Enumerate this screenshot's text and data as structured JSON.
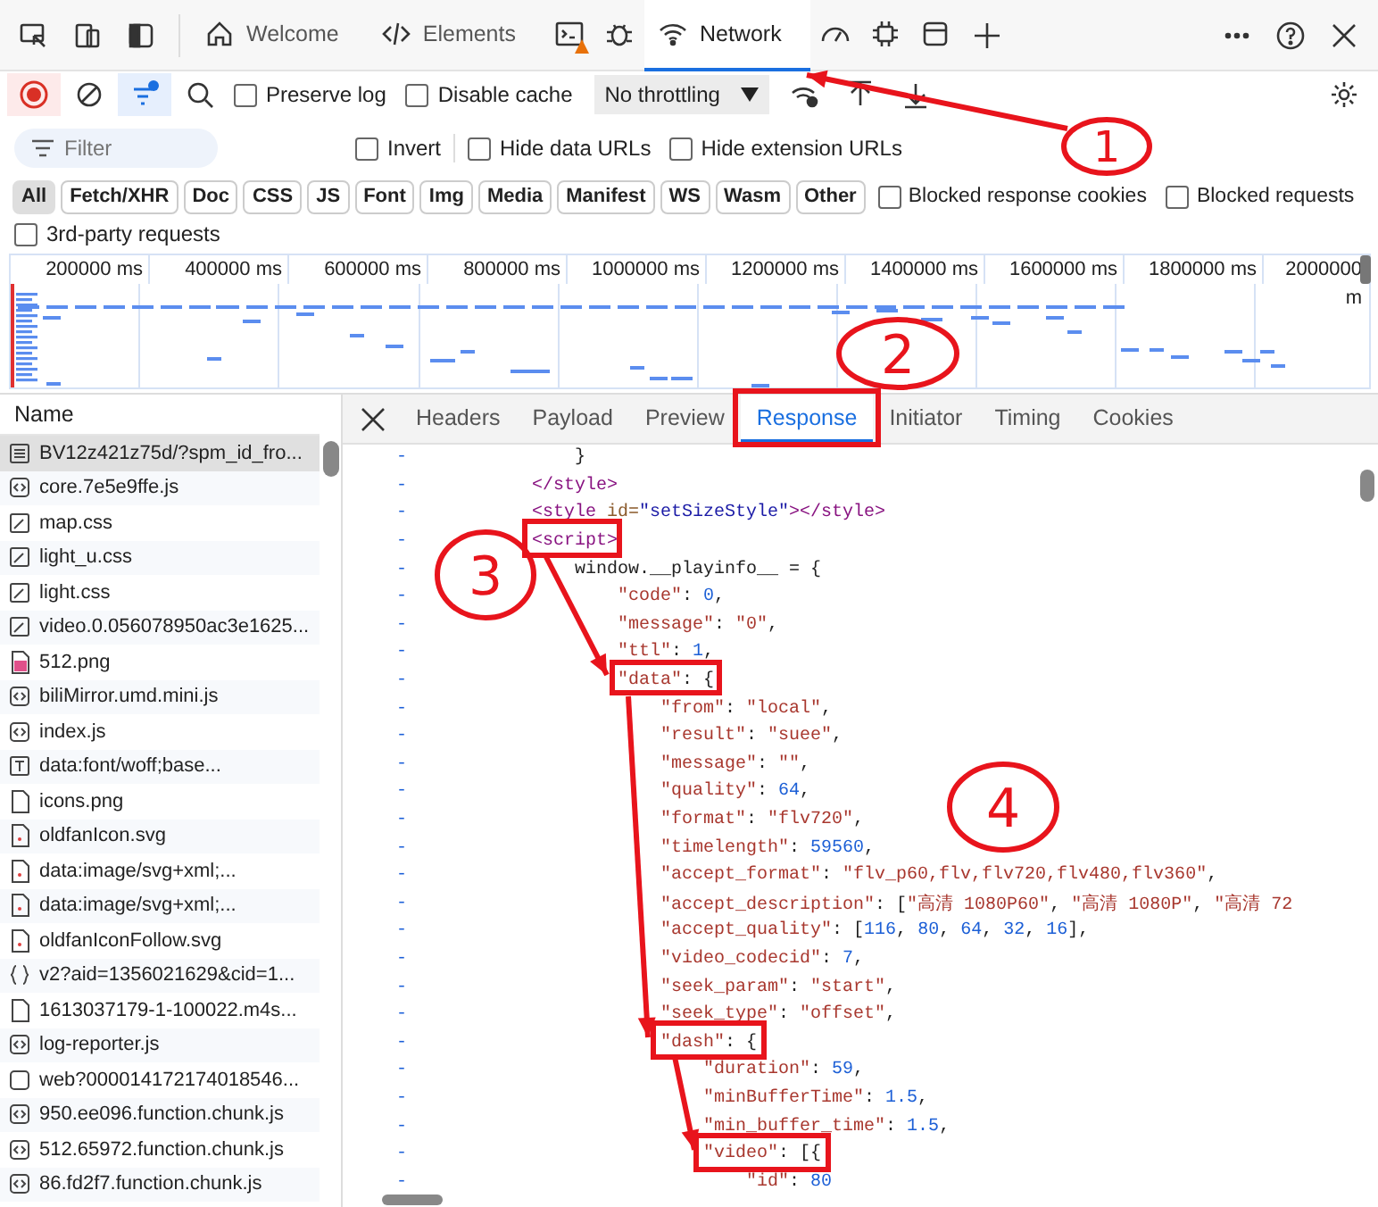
{
  "main_tabs": [
    {
      "kind": "home",
      "label": "Welcome",
      "selected": false,
      "warning": false
    },
    {
      "kind": "code",
      "label": "Elements",
      "selected": false,
      "warning": false
    },
    {
      "kind": "console",
      "selected": false,
      "warning": true
    },
    {
      "kind": "bug",
      "selected": false,
      "warning": false
    },
    {
      "kind": "wifi",
      "label": "Network",
      "selected": true,
      "warning": false
    },
    {
      "kind": "gauge",
      "selected": false,
      "warning": false
    },
    {
      "kind": "chip",
      "selected": false,
      "warning": false
    },
    {
      "kind": "window",
      "selected": false,
      "warning": false
    }
  ],
  "toolbar": {
    "recording": true,
    "filter_active": true,
    "preserve_log": {
      "label": "Preserve log",
      "checked": false
    },
    "disable_cache": {
      "label": "Disable cache",
      "checked": false
    },
    "throttling": "No throttling"
  },
  "filter": {
    "placeholder": "Filter",
    "options": [
      {
        "label": "Invert",
        "checked": false
      },
      {
        "label": "Hide data URLs",
        "checked": false
      },
      {
        "label": "Hide extension URLs",
        "checked": false
      }
    ]
  },
  "type_filters": [
    {
      "label": "All",
      "selected": true
    },
    {
      "label": "Fetch/XHR",
      "selected": false
    },
    {
      "label": "Doc",
      "selected": false
    },
    {
      "label": "CSS",
      "selected": false
    },
    {
      "label": "JS",
      "selected": false
    },
    {
      "label": "Font",
      "selected": false
    },
    {
      "label": "Img",
      "selected": false
    },
    {
      "label": "Media",
      "selected": false
    },
    {
      "label": "Manifest",
      "selected": false
    },
    {
      "label": "WS",
      "selected": false
    },
    {
      "label": "Wasm",
      "selected": false
    },
    {
      "label": "Other",
      "selected": false
    }
  ],
  "blocked_options": [
    {
      "label": "Blocked response cookies",
      "checked": false
    },
    {
      "label": "Blocked requests",
      "checked": false
    }
  ],
  "third_party": {
    "label": "3rd-party requests",
    "checked": false
  },
  "timeline_ticks": [
    "200000 ms",
    "400000 ms",
    "600000 ms",
    "800000 ms",
    "1000000 ms",
    "1200000 ms",
    "1400000 ms",
    "1600000 ms",
    "1800000 ms",
    "2000000 m"
  ],
  "requests": {
    "header": "Name",
    "rows": [
      {
        "name": "BV12z421z75d/?spm_id_fro...",
        "kind": "document",
        "selected": true
      },
      {
        "name": "core.7e5e9ffe.js",
        "kind": "script",
        "selected": false
      },
      {
        "name": "map.css",
        "kind": "stylesheet",
        "selected": false
      },
      {
        "name": "light_u.css",
        "kind": "stylesheet",
        "selected": false
      },
      {
        "name": "light.css",
        "kind": "stylesheet",
        "selected": false
      },
      {
        "name": "video.0.056078950ac3e1625...",
        "kind": "stylesheet",
        "selected": false
      },
      {
        "name": "512.png",
        "kind": "image",
        "selected": false
      },
      {
        "name": "biliMirror.umd.mini.js",
        "kind": "script",
        "selected": false
      },
      {
        "name": "index.js",
        "kind": "script",
        "selected": false
      },
      {
        "name": "data:font/woff;base...",
        "kind": "font",
        "selected": false
      },
      {
        "name": "icons.png",
        "kind": "file",
        "selected": false
      },
      {
        "name": "oldfanIcon.svg",
        "kind": "svg",
        "selected": false
      },
      {
        "name": "data:image/svg+xml;...",
        "kind": "svg",
        "selected": false
      },
      {
        "name": "data:image/svg+xml;...",
        "kind": "svg",
        "selected": false
      },
      {
        "name": "oldfanIconFollow.svg",
        "kind": "svg",
        "selected": false
      },
      {
        "name": "v2?aid=1356021629&cid=1...",
        "kind": "fetch",
        "selected": false
      },
      {
        "name": "1613037179-1-100022.m4s...",
        "kind": "file",
        "selected": false
      },
      {
        "name": "log-reporter.js",
        "kind": "script",
        "selected": false
      },
      {
        "name": "web?000014172174018546...",
        "kind": "other",
        "selected": false
      },
      {
        "name": "950.ee096.function.chunk.js",
        "kind": "script",
        "selected": false
      },
      {
        "name": "512.65972.function.chunk.js",
        "kind": "script",
        "selected": false
      },
      {
        "name": "86.fd2f7.function.chunk.js",
        "kind": "script",
        "selected": false
      }
    ]
  },
  "detail_tabs": [
    {
      "label": "Headers",
      "selected": false
    },
    {
      "label": "Payload",
      "selected": false
    },
    {
      "label": "Preview",
      "selected": false
    },
    {
      "label": "Response",
      "selected": true
    },
    {
      "label": "Initiator",
      "selected": false
    },
    {
      "label": "Timing",
      "selected": false
    },
    {
      "label": "Cookies",
      "selected": false
    }
  ],
  "response_lines": [
    {
      "children": [
        {
          "marker": "-",
          "tokens": [
            {
              "kind": "punct",
              "text": "}"
            }
          ]
        }
      ]
    },
    {
      "marker": "-",
      "tokens": [
        {
          "kind": "tag",
          "text": "</style>"
        }
      ]
    },
    {
      "marker": "-",
      "tokens": [
        {
          "kind": "tag",
          "text": "<style"
        },
        {
          "kind": "attr",
          "text": " id="
        },
        {
          "kind": "value",
          "text": "\"setSizeStyle\""
        },
        {
          "kind": "tag",
          "text": "></style>"
        }
      ]
    },
    {
      "marker": "-",
      "tokens": [
        {
          "kind": "tag",
          "text": "<script>"
        }
      ],
      "children": [
        {
          "marker": "-",
          "tokens": [
            {
              "kind": "punct",
              "text": "window.__playinfo__ = {"
            }
          ],
          "children": [
            {
              "marker": "-",
              "tokens": [
                {
                  "kind": "key",
                  "text": "\"code\""
                },
                {
                  "kind": "punct",
                  "text": ": "
                },
                {
                  "kind": "num",
                  "text": "0"
                },
                {
                  "kind": "punct",
                  "text": ","
                }
              ]
            },
            {
              "marker": "-",
              "tokens": [
                {
                  "kind": "key",
                  "text": "\"message\""
                },
                {
                  "kind": "punct",
                  "text": ": "
                },
                {
                  "kind": "str",
                  "text": "\"0\""
                },
                {
                  "kind": "punct",
                  "text": ","
                }
              ]
            },
            {
              "marker": "-",
              "tokens": [
                {
                  "kind": "key",
                  "text": "\"ttl\""
                },
                {
                  "kind": "punct",
                  "text": ": "
                },
                {
                  "kind": "num",
                  "text": "1"
                },
                {
                  "kind": "punct",
                  "text": ","
                }
              ]
            },
            {
              "marker": "-",
              "tokens": [
                {
                  "kind": "key",
                  "text": "\"data\""
                },
                {
                  "kind": "punct",
                  "text": ": {"
                }
              ],
              "children": [
                {
                  "marker": "-",
                  "tokens": [
                    {
                      "kind": "key",
                      "text": "\"from\""
                    },
                    {
                      "kind": "punct",
                      "text": ": "
                    },
                    {
                      "kind": "str",
                      "text": "\"local\""
                    },
                    {
                      "kind": "punct",
                      "text": ","
                    }
                  ]
                },
                {
                  "marker": "-",
                  "tokens": [
                    {
                      "kind": "key",
                      "text": "\"result\""
                    },
                    {
                      "kind": "punct",
                      "text": ": "
                    },
                    {
                      "kind": "str",
                      "text": "\"suee\""
                    },
                    {
                      "kind": "punct",
                      "text": ","
                    }
                  ]
                },
                {
                  "marker": "-",
                  "tokens": [
                    {
                      "kind": "key",
                      "text": "\"message\""
                    },
                    {
                      "kind": "punct",
                      "text": ": "
                    },
                    {
                      "kind": "str",
                      "text": "\"\""
                    },
                    {
                      "kind": "punct",
                      "text": ","
                    }
                  ]
                },
                {
                  "marker": "-",
                  "tokens": [
                    {
                      "kind": "key",
                      "text": "\"quality\""
                    },
                    {
                      "kind": "punct",
                      "text": ": "
                    },
                    {
                      "kind": "num",
                      "text": "64"
                    },
                    {
                      "kind": "punct",
                      "text": ","
                    }
                  ]
                },
                {
                  "marker": "-",
                  "tokens": [
                    {
                      "kind": "key",
                      "text": "\"format\""
                    },
                    {
                      "kind": "punct",
                      "text": ": "
                    },
                    {
                      "kind": "str",
                      "text": "\"flv720\""
                    },
                    {
                      "kind": "punct",
                      "text": ","
                    }
                  ]
                },
                {
                  "marker": "-",
                  "tokens": [
                    {
                      "kind": "key",
                      "text": "\"timelength\""
                    },
                    {
                      "kind": "punct",
                      "text": ": "
                    },
                    {
                      "kind": "num",
                      "text": "59560"
                    },
                    {
                      "kind": "punct",
                      "text": ","
                    }
                  ]
                },
                {
                  "marker": "-",
                  "tokens": [
                    {
                      "kind": "key",
                      "text": "\"accept_format\""
                    },
                    {
                      "kind": "punct",
                      "text": ": "
                    },
                    {
                      "kind": "str",
                      "text": "\"flv_p60,flv,flv720,flv480,flv360\""
                    },
                    {
                      "kind": "punct",
                      "text": ","
                    }
                  ]
                },
                {
                  "marker": "-",
                  "tokens": [
                    {
                      "kind": "key",
                      "text": "\"accept_description\""
                    },
                    {
                      "kind": "punct",
                      "text": ": ["
                    },
                    {
                      "kind": "str",
                      "text": "\"高清 1080P60\""
                    },
                    {
                      "kind": "punct",
                      "text": ", "
                    },
                    {
                      "kind": "str",
                      "text": "\"高清 1080P\""
                    },
                    {
                      "kind": "punct",
                      "text": ", "
                    },
                    {
                      "kind": "str",
                      "text": "\"高清 72"
                    }
                  ]
                },
                {
                  "marker": "-",
                  "tokens": [
                    {
                      "kind": "key",
                      "text": "\"accept_quality\""
                    },
                    {
                      "kind": "punct",
                      "text": ": ["
                    },
                    {
                      "kind": "num",
                      "text": "116"
                    },
                    {
                      "kind": "punct",
                      "text": ", "
                    },
                    {
                      "kind": "num",
                      "text": "80"
                    },
                    {
                      "kind": "punct",
                      "text": ", "
                    },
                    {
                      "kind": "num",
                      "text": "64"
                    },
                    {
                      "kind": "punct",
                      "text": ", "
                    },
                    {
                      "kind": "num",
                      "text": "32"
                    },
                    {
                      "kind": "punct",
                      "text": ", "
                    },
                    {
                      "kind": "num",
                      "text": "16"
                    },
                    {
                      "kind": "punct",
                      "text": "],"
                    }
                  ]
                },
                {
                  "marker": "-",
                  "tokens": [
                    {
                      "kind": "key",
                      "text": "\"video_codecid\""
                    },
                    {
                      "kind": "punct",
                      "text": ": "
                    },
                    {
                      "kind": "num",
                      "text": "7"
                    },
                    {
                      "kind": "punct",
                      "text": ","
                    }
                  ]
                },
                {
                  "marker": "-",
                  "tokens": [
                    {
                      "kind": "key",
                      "text": "\"seek_param\""
                    },
                    {
                      "kind": "punct",
                      "text": ": "
                    },
                    {
                      "kind": "str",
                      "text": "\"start\""
                    },
                    {
                      "kind": "punct",
                      "text": ","
                    }
                  ]
                },
                {
                  "marker": "-",
                  "tokens": [
                    {
                      "kind": "key",
                      "text": "\"seek_type\""
                    },
                    {
                      "kind": "punct",
                      "text": ": "
                    },
                    {
                      "kind": "str",
                      "text": "\"offset\""
                    },
                    {
                      "kind": "punct",
                      "text": ","
                    }
                  ]
                },
                {
                  "marker": "-",
                  "tokens": [
                    {
                      "kind": "key",
                      "text": "\"dash\""
                    },
                    {
                      "kind": "punct",
                      "text": ": {"
                    }
                  ],
                  "children": [
                    {
                      "marker": "-",
                      "tokens": [
                        {
                          "kind": "key",
                          "text": "\"duration\""
                        },
                        {
                          "kind": "punct",
                          "text": ": "
                        },
                        {
                          "kind": "num",
                          "text": "59"
                        },
                        {
                          "kind": "punct",
                          "text": ","
                        }
                      ]
                    },
                    {
                      "marker": "-",
                      "tokens": [
                        {
                          "kind": "key",
                          "text": "\"minBufferTime\""
                        },
                        {
                          "kind": "punct",
                          "text": ": "
                        },
                        {
                          "kind": "num",
                          "text": "1.5"
                        },
                        {
                          "kind": "punct",
                          "text": ","
                        }
                      ]
                    },
                    {
                      "marker": "-",
                      "tokens": [
                        {
                          "kind": "key",
                          "text": "\"min_buffer_time\""
                        },
                        {
                          "kind": "punct",
                          "text": ": "
                        },
                        {
                          "kind": "num",
                          "text": "1.5"
                        },
                        {
                          "kind": "punct",
                          "text": ","
                        }
                      ]
                    },
                    {
                      "marker": "-",
                      "tokens": [
                        {
                          "kind": "key",
                          "text": "\"video\""
                        },
                        {
                          "kind": "punct",
                          "text": ": [{"
                        }
                      ],
                      "children": [
                        {
                          "marker": "-",
                          "tokens": [
                            {
                              "kind": "key",
                              "text": "\"id\""
                            },
                            {
                              "kind": "punct",
                              "text": ": "
                            },
                            {
                              "kind": "num",
                              "text": "80"
                            }
                          ]
                        }
                      ]
                    }
                  ]
                }
              ]
            }
          ]
        }
      ]
    }
  ],
  "annotation_numbers": [
    "1",
    "2",
    "3",
    "4"
  ]
}
